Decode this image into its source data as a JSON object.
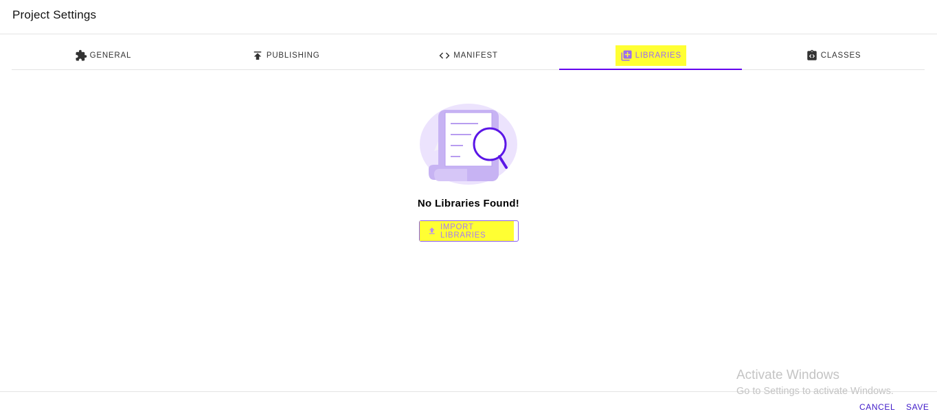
{
  "header": {
    "title": "Project Settings"
  },
  "tabs": [
    {
      "label": "GENERAL",
      "icon": "puzzle-icon"
    },
    {
      "label": "PUBLISHING",
      "icon": "publish-icon"
    },
    {
      "label": "MANIFEST",
      "icon": "code-icon"
    },
    {
      "label": "LIBRARIES",
      "icon": "library-add-icon",
      "active": true
    },
    {
      "label": "CLASSES",
      "icon": "class-code-icon"
    }
  ],
  "empty_state": {
    "title": "No Libraries Found!",
    "button_label": "IMPORT LIBRARIES",
    "illustration": "document-search-illustration"
  },
  "footer": {
    "cancel_label": "CANCEL",
    "save_label": "SAVE"
  },
  "watermark": {
    "title": "Activate Windows",
    "subtitle": "Go to Settings to activate Windows."
  },
  "colors": {
    "accent": "#6200ee",
    "highlight": "#ffff33",
    "button_text": "#3d18c8",
    "illustration_purple": "#c9b3f5"
  }
}
